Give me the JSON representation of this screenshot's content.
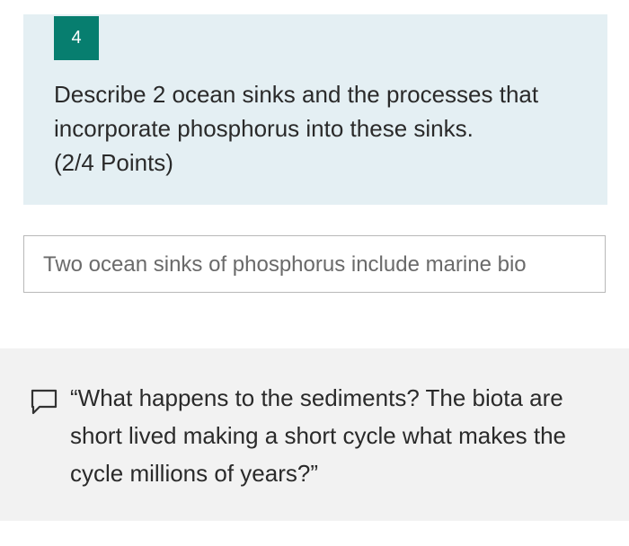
{
  "question": {
    "number": "4",
    "text": "Describe 2 ocean sinks and the processes that incorporate phosphorus into these sinks.",
    "points": "(2/4 Points)"
  },
  "answer": {
    "value": "Two ocean sinks of phosphorus include marine bio"
  },
  "feedback": {
    "icon": "comment-icon",
    "text": "“What happens to the sediments? The biota are short lived making a short cycle what makes the cycle millions of years?”"
  },
  "colors": {
    "accent": "#077e6f",
    "question_background": "#e4eff3",
    "feedback_background": "#f2f2f2"
  }
}
